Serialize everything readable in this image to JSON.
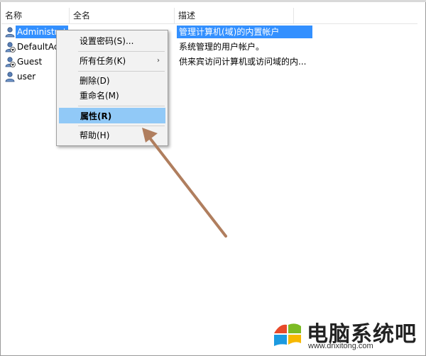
{
  "columns": {
    "name": "名称",
    "fullname": "全名",
    "description": "描述"
  },
  "users": [
    {
      "name": "Administrat",
      "fullname": "",
      "description": "管理计算机(域)的内置帐户",
      "selected": true
    },
    {
      "name": "DefaultAcc",
      "fullname": "",
      "description": "系统管理的用户帐户。",
      "selected": false
    },
    {
      "name": "Guest",
      "fullname": "",
      "description": "供来宾访问计算机或访问域的内...",
      "selected": false
    },
    {
      "name": "user",
      "fullname": "",
      "description": "",
      "selected": false
    }
  ],
  "context_menu": {
    "set_password": "设置密码(S)...",
    "all_tasks": "所有任务(K)",
    "all_tasks_arrow": "›",
    "delete": "删除(D)",
    "rename": "重命名(M)",
    "properties": "属性(R)",
    "help": "帮助(H)"
  },
  "watermark": {
    "brand": "电脑系统吧",
    "url": "www.dnxitong.com"
  },
  "colors": {
    "selection": "#3390ff",
    "menu_highlight": "#91c9f7",
    "arrow": "#b07e5e"
  }
}
